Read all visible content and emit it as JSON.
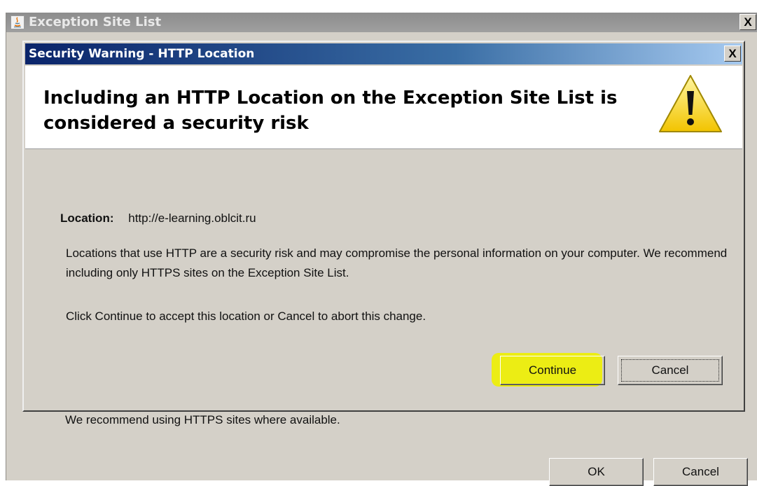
{
  "outer_window": {
    "title": "Exception Site List",
    "close_label": "X",
    "recommendation": "We recommend using HTTPS sites where available.",
    "ok_label": "OK",
    "cancel_label": "Cancel"
  },
  "dialog": {
    "title": "Security Warning - HTTP Location",
    "close_label": "X",
    "heading": "Including an HTTP Location on the Exception Site List is considered a security risk",
    "location_label": "Location:",
    "location_value": "http://e-learning.oblcit.ru",
    "description": "Locations that use HTTP are a security risk and may compromise the personal information on your computer.  We recommend including only HTTPS sites on the Exception Site List.",
    "instruction": "Click Continue to accept this location or Cancel to abort this change.",
    "continue_label": "Continue",
    "cancel_label": "Cancel",
    "warning_icon": "warning-triangle-icon",
    "highlight_color": "#eef000"
  }
}
